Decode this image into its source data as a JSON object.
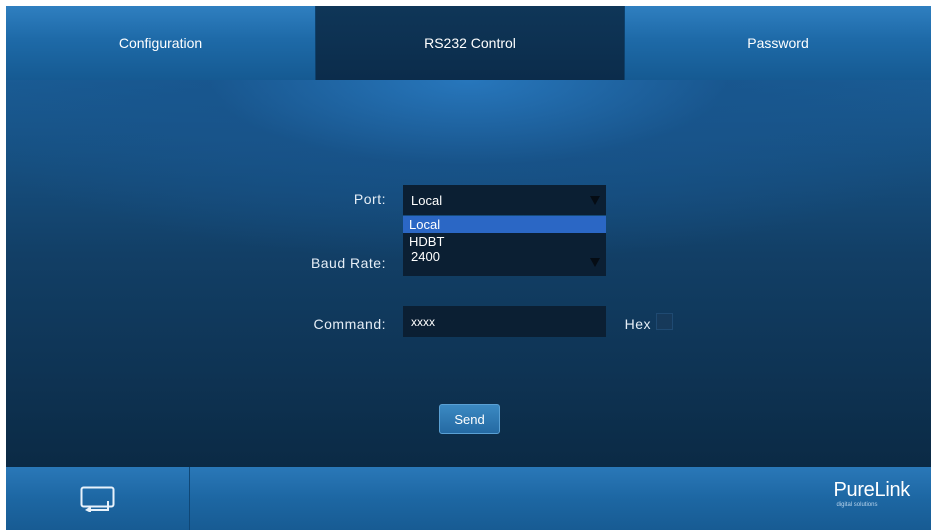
{
  "tabs": [
    {
      "label": "Configuration"
    },
    {
      "label": "RS232 Control"
    },
    {
      "label": "Password"
    }
  ],
  "active_tab": "RS232 Control",
  "form": {
    "port_label": "Port:",
    "port_value": "Local",
    "port_options": [
      "Local",
      "HDBT"
    ],
    "baud_label": "Baud Rate:",
    "baud_value": "2400",
    "command_label": "Command:",
    "command_value": "xxxx",
    "hex_label": "Hex",
    "hex_checked": false,
    "send_label": "Send"
  },
  "footer": {
    "icon": "swap-screen-icon",
    "brand": "PureLink",
    "tagline": "digital solutions"
  },
  "colors": {
    "tab_blue": "#1e6aa8",
    "active_tab": "#0f3658",
    "panel": "#123f66",
    "field_bg": "#0b1f33",
    "selected_option": "#2b67c5",
    "button": "#2f7ab4"
  }
}
